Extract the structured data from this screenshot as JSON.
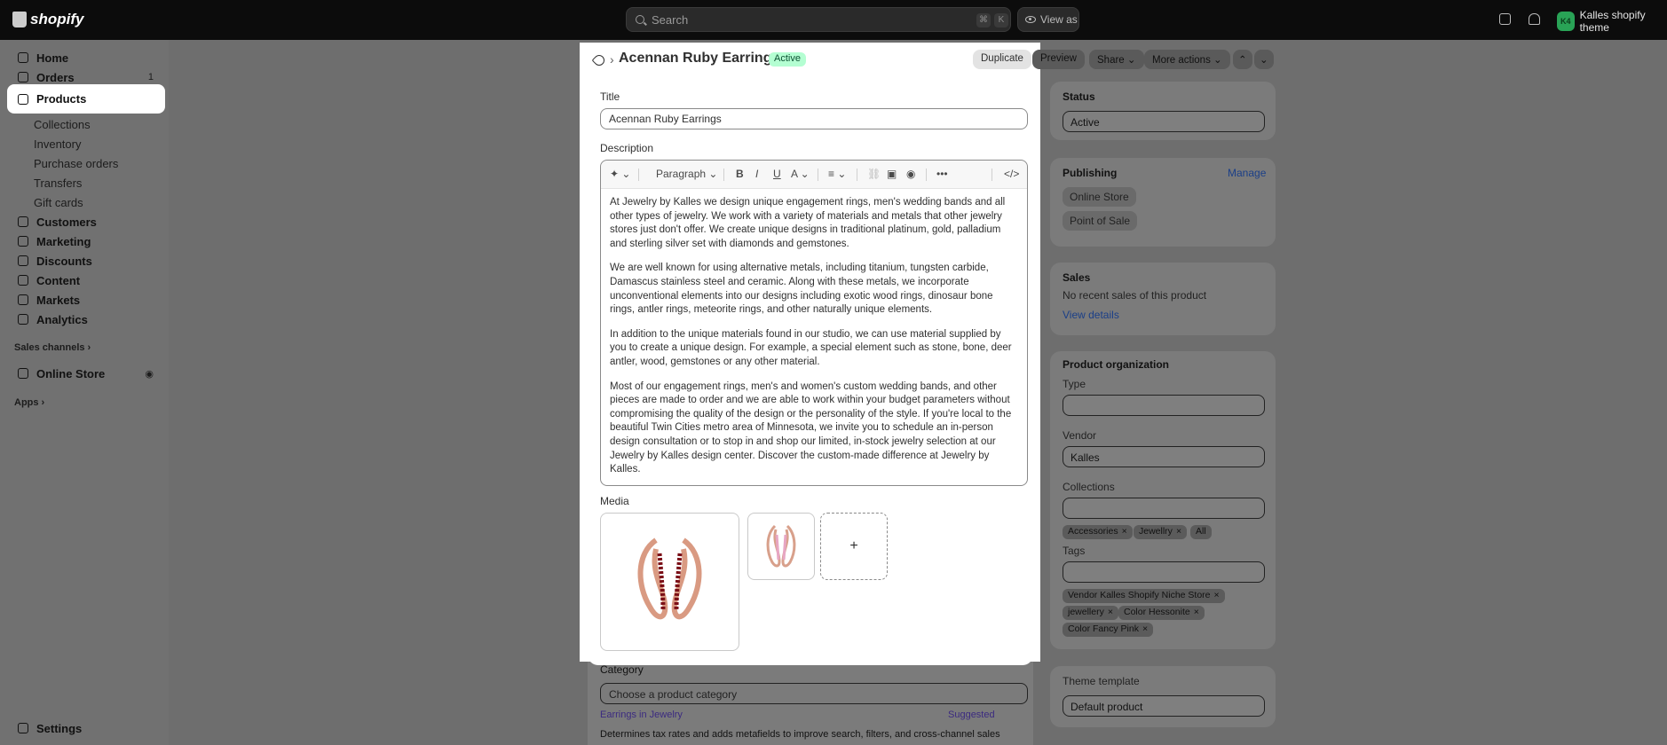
{
  "topbar": {
    "brand": "shopify",
    "search_placeholder": "Search",
    "kbd": [
      "⌘",
      "K"
    ],
    "view_as": "View as",
    "avatar_initials": "K4",
    "store_name": "Kalles shopify theme"
  },
  "sidebar": {
    "items": [
      {
        "label": "Home"
      },
      {
        "label": "Orders",
        "badge": "1"
      },
      {
        "label": "Products"
      },
      {
        "label": "Collections"
      },
      {
        "label": "Inventory"
      },
      {
        "label": "Purchase orders"
      },
      {
        "label": "Transfers"
      },
      {
        "label": "Gift cards"
      },
      {
        "label": "Customers"
      },
      {
        "label": "Marketing"
      },
      {
        "label": "Discounts"
      },
      {
        "label": "Content"
      },
      {
        "label": "Markets"
      },
      {
        "label": "Analytics"
      }
    ],
    "sales_channels": "Sales channels",
    "online_store": "Online Store",
    "apps": "Apps",
    "settings": "Settings"
  },
  "header": {
    "title": "Acennan Ruby Earrings",
    "status": "Active",
    "buttons": {
      "duplicate": "Duplicate",
      "preview": "Preview",
      "share": "Share",
      "more": "More actions"
    }
  },
  "product": {
    "title_label": "Title",
    "title_value": "Acennan Ruby Earrings",
    "description_label": "Description",
    "paragraph_select": "Paragraph",
    "description": [
      "At Jewelry by Kalles we design unique engagement rings, men's wedding bands and all other types of jewelry. We work with a variety of materials and metals that other jewelry stores just don't offer. We create unique designs in traditional platinum, gold, palladium and sterling silver set with diamonds and gemstones.",
      "We are well known for using alternative metals, including titanium, tungsten carbide, Damascus stainless steel and ceramic. Along with these metals, we incorporate unconventional elements into our designs including exotic wood rings, dinosaur bone rings, antler rings, meteorite rings, and other naturally unique elements.",
      "In addition to the unique materials found in our studio, we can use material supplied by you to create a unique design. For example, a special element such as stone, bone, deer antler, wood, gemstones or any other material.",
      "Most of our engagement rings, men's and women's custom wedding bands, and other pieces are made to order and we are able to work within your budget parameters without compromising the quality of the design or the personality of the style. If you're local to the beautiful Twin Cities metro area of Minnesota, we invite you to schedule an in-person design consultation or to stop in and shop our limited, in-stock jewelry selection at our Jewelry by Kalles design center. Discover the custom-made difference at Jewelry by Kalles."
    ],
    "media_label": "Media",
    "category_label": "Category",
    "category_placeholder": "Choose a product category",
    "category_suggestion": "Earrings in Jewelry",
    "suggested": "Suggested",
    "category_help": "Determines tax rates and adds metafields to improve search, filters, and cross-channel sales"
  },
  "right": {
    "status_label": "Status",
    "status_value": "Active",
    "publishing_label": "Publishing",
    "manage": "Manage",
    "channels": [
      "Online Store",
      "Point of Sale"
    ],
    "sales_label": "Sales",
    "sales_text": "No recent sales of this product",
    "view_details": "View details",
    "org_label": "Product organization",
    "type_label": "Type",
    "vendor_label": "Vendor",
    "vendor_value": "Kalles",
    "collections_label": "Collections",
    "collections": [
      "Accessories",
      "Jewellry"
    ],
    "collections_all": "All",
    "tags_label": "Tags",
    "tags": [
      "Vendor Kalles Shopify Niche Store",
      "jewellery",
      "Color Hessonite",
      "Color Fancy Pink"
    ],
    "theme_label": "Theme template",
    "theme_value": "Default product"
  }
}
